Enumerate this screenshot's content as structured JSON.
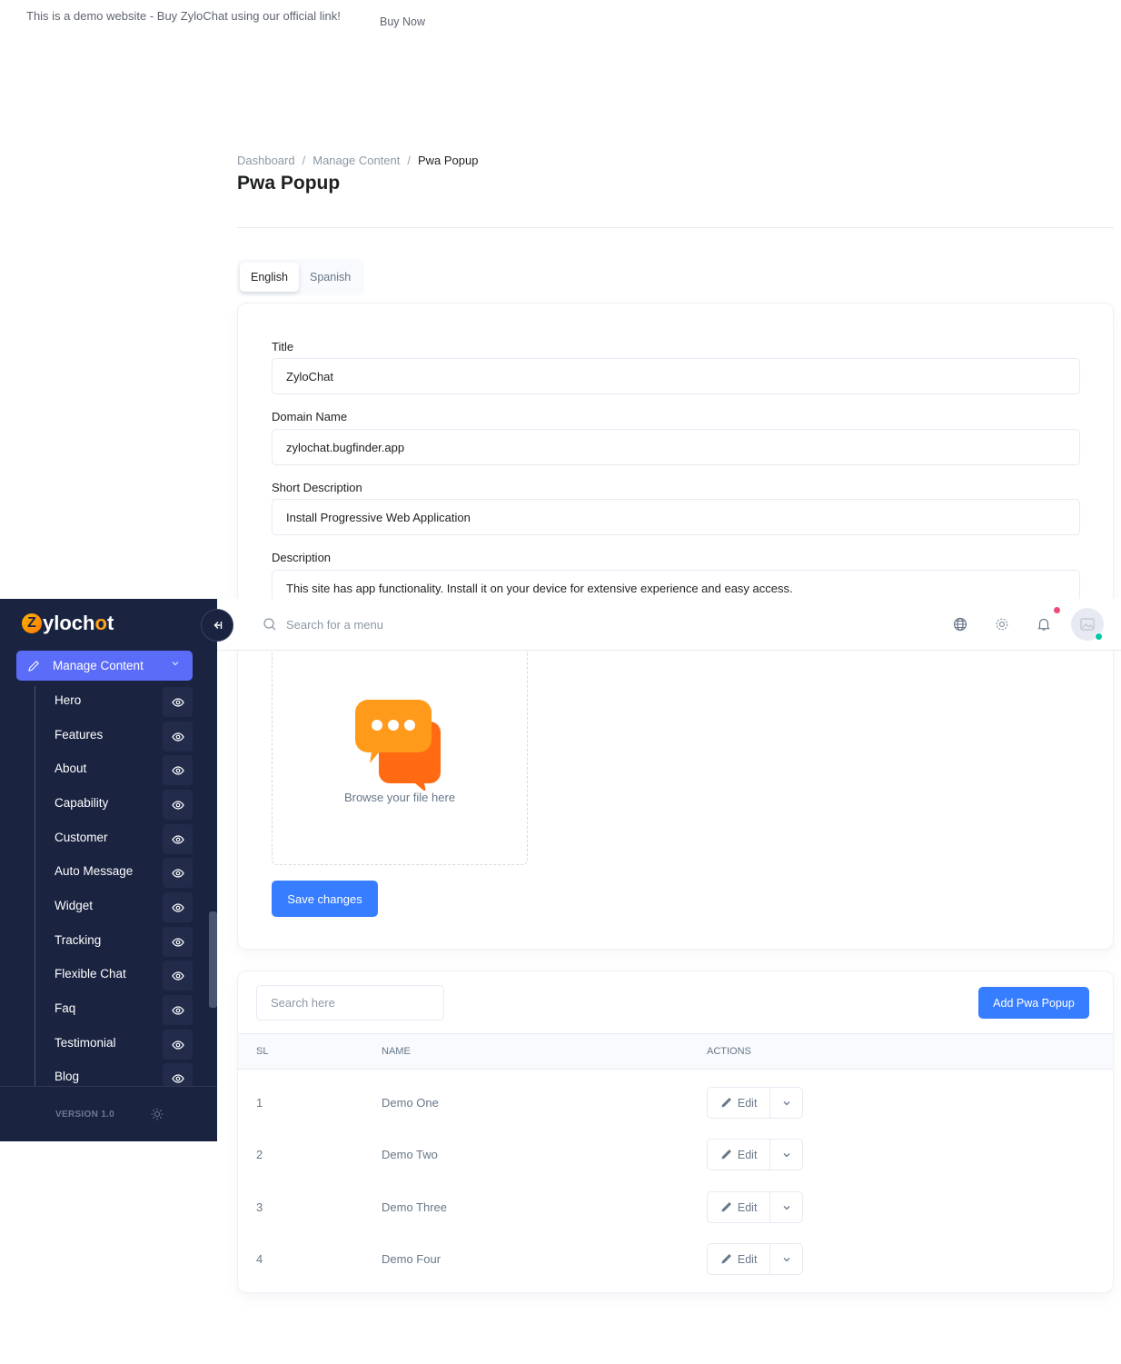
{
  "banner": {
    "text": "This is a demo website - Buy ZyloChat using our official link!",
    "buy_now": "Buy Now"
  },
  "breadcrumb": [
    "Dashboard",
    "Manage Content",
    "Pwa Popup"
  ],
  "page_title": "Pwa Popup",
  "language_tabs": [
    {
      "label": "English",
      "active": true
    },
    {
      "label": "Spanish",
      "active": false
    }
  ],
  "form": {
    "title_label": "Title",
    "title_value": "ZyloChat",
    "domain_label": "Domain Name",
    "domain_value": "zylochat.bugfinder.app",
    "short_desc_label": "Short Description",
    "short_desc_value": "Install Progressive Web Application",
    "desc_label": "Description",
    "desc_value": "This site has app functionality. Install it on your device for extensive experience and easy access.",
    "upload_text": "Browse your file here",
    "save_label": "Save changes"
  },
  "table": {
    "search_placeholder": "Search here",
    "add_label": "Add Pwa Popup",
    "headers": [
      "SL",
      "NAME",
      "ACTIONS"
    ],
    "edit_label": "Edit",
    "rows": [
      {
        "sl": "1",
        "name": "Demo One"
      },
      {
        "sl": "2",
        "name": "Demo Two"
      },
      {
        "sl": "3",
        "name": "Demo Three"
      },
      {
        "sl": "4",
        "name": "Demo Four"
      }
    ]
  },
  "navbar": {
    "search_placeholder": "Search for a menu",
    "icons": [
      "globe-icon",
      "gear-icon",
      "bell-icon",
      "avatar"
    ]
  },
  "sidebar": {
    "logo": {
      "pre": "Z",
      "mid": "ylo",
      "ch": "ch",
      "o": "o",
      "t": "t"
    },
    "parent_label": "Manage Content",
    "items": [
      "Hero",
      "Features",
      "About",
      "Capability",
      "Customer",
      "Auto Message",
      "Widget",
      "Tracking",
      "Flexible Chat",
      "Faq",
      "Testimonial",
      "Blog"
    ],
    "version": "VERSION 1.0"
  },
  "colors": {
    "primary": "#377dff",
    "sidebar_bg": "#1a2340",
    "sidebar_active": "#5b6cf9",
    "notification": "#ed4c78",
    "online": "#00c9a7"
  }
}
